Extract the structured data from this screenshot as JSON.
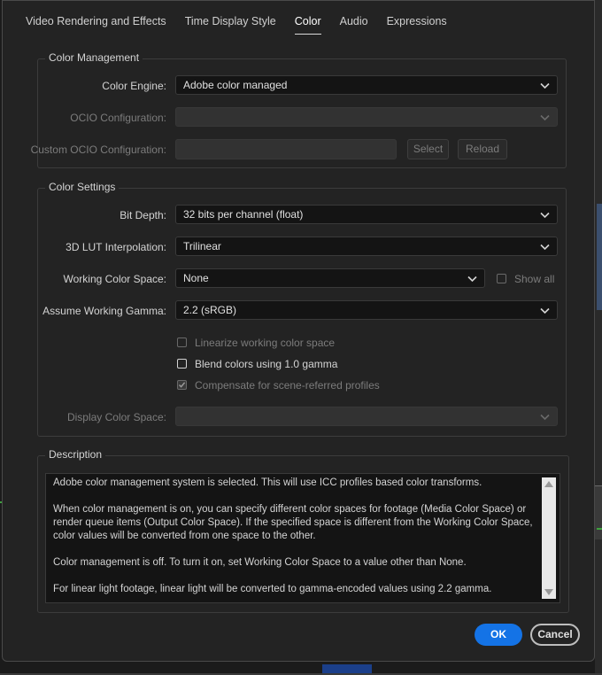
{
  "tabs": [
    "Video Rendering and Effects",
    "Time Display Style",
    "Color",
    "Audio",
    "Expressions"
  ],
  "active_tab": "Color",
  "color_management": {
    "title": "Color Management",
    "color_engine_label": "Color Engine:",
    "color_engine_value": "Adobe color managed",
    "ocio_config_label": "OCIO Configuration:",
    "ocio_config_value": "",
    "custom_ocio_label": "Custom OCIO Configuration:",
    "select_label": "Select",
    "reload_label": "Reload"
  },
  "color_settings": {
    "title": "Color Settings",
    "bit_depth_label": "Bit Depth:",
    "bit_depth_value": "32 bits per channel (float)",
    "lut_label": "3D LUT Interpolation:",
    "lut_value": "Trilinear",
    "working_space_label": "Working Color Space:",
    "working_space_value": "None",
    "show_all_label": "Show all",
    "gamma_label": "Assume Working Gamma:",
    "gamma_value": "2.2 (sRGB)",
    "linearize_label": "Linearize working color space",
    "blend_label": "Blend colors using 1.0 gamma",
    "compensate_label": "Compensate for scene-referred profiles",
    "display_space_label": "Display Color Space:",
    "display_space_value": ""
  },
  "description": {
    "title": "Description",
    "paragraphs": [
      "Adobe color management system is selected. This will use ICC profiles based color transforms.",
      "When color management is on, you can specify different color spaces for footage (Media Color Space) or render queue items (Output Color Space). If the specified space is different from the Working Color Space, color values will be converted from one space to the other.",
      "Color management is off. To turn it on, set Working Color Space to a value other than None.",
      "For linear light footage, linear light will be converted to gamma-encoded values using 2.2 gamma."
    ]
  },
  "buttons": {
    "ok": "OK",
    "cancel": "Cancel"
  },
  "colors": {
    "accent": "#1473e6",
    "background": "#232323",
    "field": "#141414"
  },
  "icons": {
    "dropdown": "chevron-down-icon",
    "checkmark": "checkmark-icon"
  }
}
